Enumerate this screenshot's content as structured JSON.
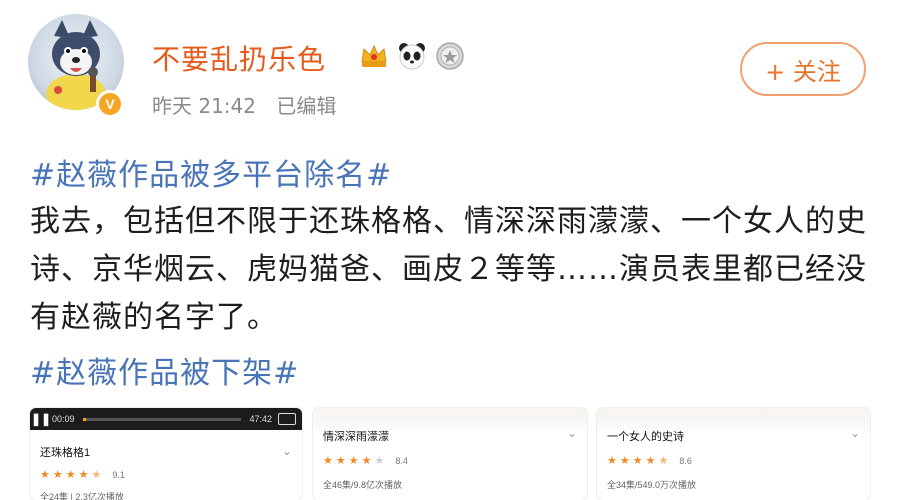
{
  "post": {
    "username": "不要乱扔乐色",
    "time": "昨天 21:42",
    "edited": "已编辑",
    "verified_mark": "V",
    "follow_label": "+ 关注",
    "badges": [
      "crown-badge",
      "panda-badge",
      "medal-badge"
    ],
    "hashtag_top": "#赵薇作品被多平台除名#",
    "body": "我去，包括但不限于还珠格格、情深深雨濛濛、一个女人的史诗、京华烟云、虎妈猫爸、画皮２等等……演员表里都已经没有赵薇的名字了。",
    "hashtag_bottom": "#赵薇作品被下架#"
  },
  "cards": [
    {
      "title": "还珠格格1",
      "rating": 4.5,
      "score": "9.1",
      "plays": "全24集 | 2.3亿次播放",
      "player": {
        "current": "00:09",
        "total": "47:42",
        "progress": 0.003
      }
    },
    {
      "title": "情深深雨濛濛",
      "rating": 4,
      "score": "8.4",
      "plays": "全46集/9.8亿次播放"
    },
    {
      "title": "一个女人的史诗",
      "rating": 4.5,
      "score": "8.6",
      "plays": "全34集/549.0万次播放"
    }
  ],
  "colors": {
    "username": "#e85a1b",
    "hashtag": "#4a74b8",
    "follow_border": "#f1a06e",
    "star": "#f08a24",
    "verified": "#f5a623"
  }
}
